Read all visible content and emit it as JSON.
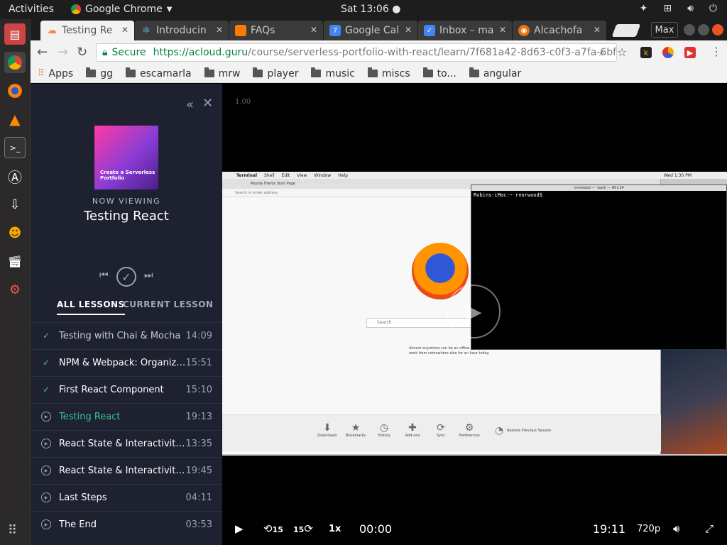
{
  "topbar": {
    "activities": "Activities",
    "app_name": "Google Chrome",
    "clock": "Sat 13:06"
  },
  "launcher": {
    "icons": [
      "files-icon",
      "chrome-icon",
      "firefox-icon",
      "vlc-icon",
      "terminal-icon",
      "software-updater-icon",
      "transfer-icon",
      "people-icon",
      "video-editor-icon",
      "settings-icon"
    ]
  },
  "tabs": [
    {
      "label": "Testing Re",
      "favicon_color": "#ff8a3d",
      "active": true
    },
    {
      "label": "Introducin",
      "favicon_color": "#61dafb",
      "active": false
    },
    {
      "label": "FAQs",
      "favicon_color": "#ff7a00",
      "active": false
    },
    {
      "label": "Google Cal",
      "favicon_color": "#4285f4",
      "favicon_text": "7",
      "active": false
    },
    {
      "label": "Inbox – ma",
      "favicon_color": "#4285f4",
      "active": false
    },
    {
      "label": "Alcachofa",
      "favicon_color": "#e8730c",
      "active": false
    }
  ],
  "window": {
    "profile": "Max"
  },
  "omnibox": {
    "secure": "Secure",
    "host": "https://acloud.guru",
    "path": "/course/serverless-portfolio-with-react/learn/7f681a42-8d63-c0f3-a7fa-6bff..."
  },
  "bookmarks": [
    {
      "label": "Apps",
      "type": "apps"
    },
    {
      "label": "gg",
      "type": "folder"
    },
    {
      "label": "escamarla",
      "type": "folder"
    },
    {
      "label": "mrw",
      "type": "folder"
    },
    {
      "label": "player",
      "type": "folder"
    },
    {
      "label": "music",
      "type": "folder"
    },
    {
      "label": "miscs",
      "type": "folder"
    },
    {
      "label": "to...",
      "type": "folder"
    },
    {
      "label": "angular",
      "type": "folder"
    }
  ],
  "sidebar": {
    "course_image_text": "Create a Serverless Portfolio",
    "now_viewing": "NOW VIEWING",
    "now_title": "Testing React",
    "tab_all": "ALL LESSONS",
    "tab_current": "CURRENT LESSON",
    "lessons": [
      {
        "title": "Testing with Chai & Mocha",
        "duration": "14:09",
        "state": "done-dim"
      },
      {
        "title": "NPM & Webpack: Organizing ...",
        "duration": "15:51",
        "state": "done"
      },
      {
        "title": "First React Component",
        "duration": "15:10",
        "state": "done"
      },
      {
        "title": "Testing React",
        "duration": "19:13",
        "state": "current"
      },
      {
        "title": "React State & Interactivity Pa...",
        "duration": "13:35",
        "state": "todo"
      },
      {
        "title": "React State & Interactivity Pa...",
        "duration": "19:45",
        "state": "todo"
      },
      {
        "title": "Last Steps",
        "duration": "04:11",
        "state": "todo"
      },
      {
        "title": "The End",
        "duration": "03:53",
        "state": "todo"
      }
    ]
  },
  "video": {
    "speed_mark": "1.00",
    "mac_menu": [
      "Terminal",
      "Shell",
      "Edit",
      "View",
      "Window",
      "Help"
    ],
    "mac_clock": "Wed 1:30 PM",
    "ff_tab": "Mozilla Firefox Start Page",
    "ff_url_placeholder": "Search or enter address",
    "ff_search": "Search",
    "ff_snippet": "Almost anywhere can be an office. Get outside and work from somewhere else for an hour today.",
    "ff_toolbar": [
      "Downloads",
      "Bookmarks",
      "History",
      "Add-ons",
      "Sync",
      "Preferences"
    ],
    "ff_restore": "Restore Previous Session",
    "term_title": "rnorwood — -bash — 80×24",
    "term_prompt": "Robins-iMac:~ rnorwood$",
    "controls": {
      "rewind": "15",
      "forward": "15",
      "speed": "1x",
      "time": "00:00",
      "duration": "19:11",
      "quality": "720p"
    }
  }
}
